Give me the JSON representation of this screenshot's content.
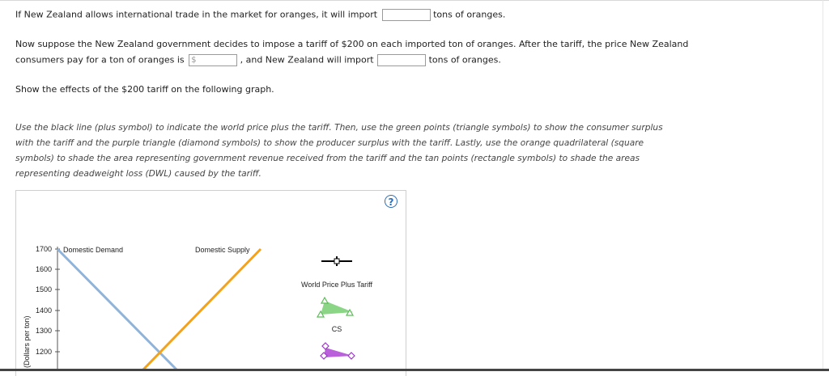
{
  "question": {
    "line1_prefix": "If New Zealand allows international trade in the market for oranges, it will import",
    "line1_suffix": "tons of oranges.",
    "line2": "Now suppose the New Zealand government decides to impose a tariff of $200 on each imported ton of oranges. After the tariff, the price New Zealand",
    "line3_prefix": "consumers pay for a ton of oranges is",
    "price_placeholder": "$",
    "line3_mid": ", and New Zealand will import",
    "line3_suffix": "tons of oranges.",
    "show_effects": "Show the effects of the $200 tariff on the following graph."
  },
  "instructions": {
    "line1": "Use the black line (plus symbol) to indicate the world price plus the tariff. Then, use the green points (triangle symbols) to show the consumer surplus",
    "line2": "with the tariff and the purple triangle (diamond symbols) to show the producer surplus with the tariff. Lastly, use the orange quadrilateral (square",
    "line3": "symbols) to shade the area representing government revenue received from the tariff and the tan points (rectangle symbols) to shade the areas",
    "line4": "representing deadweight loss (DWL) caused by the tariff."
  },
  "graph": {
    "help_symbol": "?",
    "y_axis_label": "(Dollars per ton)",
    "demand_label": "Domestic Demand",
    "supply_label": "Domestic Supply",
    "y_ticks": [
      "1700",
      "1600",
      "1500",
      "1400",
      "1300",
      "1200"
    ],
    "colors": {
      "demand": "#8fb3d9",
      "supply": "#f5a21b",
      "cs_tool": "#7ed07a",
      "ps_tool": "#b14fd6",
      "world_price_tool": "#000000"
    },
    "tools": {
      "world_price_label": "World Price Plus Tariff",
      "cs_label": "CS"
    }
  }
}
